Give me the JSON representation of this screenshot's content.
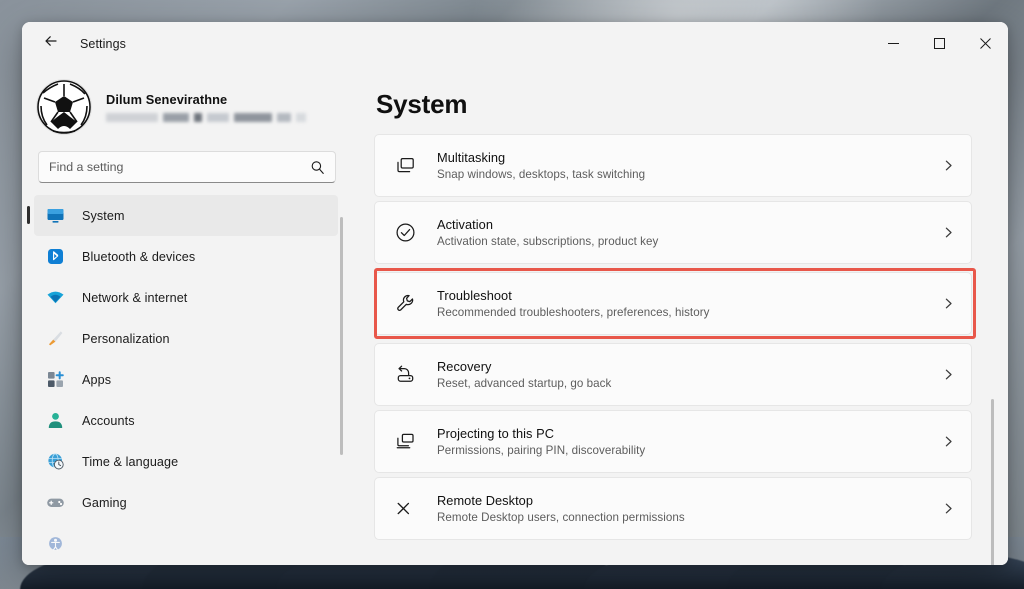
{
  "window": {
    "app_title": "Settings",
    "back_icon": "back-arrow-icon",
    "controls": {
      "minimize": "minimize-icon",
      "maximize": "maximize-icon",
      "close": "close-icon"
    }
  },
  "sidebar": {
    "profile": {
      "name": "Dilum Senevirathne",
      "account_line_redacted": true,
      "avatar_icon": "soccer-ball-avatar"
    },
    "search": {
      "placeholder": "Find a setting",
      "value": "",
      "icon": "search-icon"
    },
    "items": [
      {
        "label": "System",
        "icon": "monitor-icon",
        "active": true
      },
      {
        "label": "Bluetooth & devices",
        "icon": "bluetooth-icon",
        "active": false
      },
      {
        "label": "Network & internet",
        "icon": "wifi-icon",
        "active": false
      },
      {
        "label": "Personalization",
        "icon": "paintbrush-icon",
        "active": false
      },
      {
        "label": "Apps",
        "icon": "apps-grid-icon",
        "active": false
      },
      {
        "label": "Accounts",
        "icon": "person-icon",
        "active": false
      },
      {
        "label": "Time & language",
        "icon": "clock-globe-icon",
        "active": false
      },
      {
        "label": "Gaming",
        "icon": "gamepad-icon",
        "active": false
      }
    ]
  },
  "main": {
    "title": "System",
    "cards": [
      {
        "title": "Multitasking",
        "subtitle": "Snap windows, desktops, task switching",
        "icon": "multitasking-windows-icon",
        "highlighted": false
      },
      {
        "title": "Activation",
        "subtitle": "Activation state, subscriptions, product key",
        "icon": "check-circle-icon",
        "highlighted": false
      },
      {
        "title": "Troubleshoot",
        "subtitle": "Recommended troubleshooters, preferences, history",
        "icon": "wrench-icon",
        "highlighted": true
      },
      {
        "title": "Recovery",
        "subtitle": "Reset, advanced startup, go back",
        "icon": "recovery-icon",
        "highlighted": false
      },
      {
        "title": "Projecting to this PC",
        "subtitle": "Permissions, pairing PIN, discoverability",
        "icon": "projecting-icon",
        "highlighted": false
      },
      {
        "title": "Remote Desktop",
        "subtitle": "Remote Desktop users, connection permissions",
        "icon": "remote-desktop-icon",
        "highlighted": false
      }
    ],
    "chevron_icon": "chevron-right-icon"
  },
  "colors": {
    "highlight": "#e8574a",
    "window_bg": "#f3f3f3",
    "card_bg": "#fbfbfb",
    "accent_pill": "#2e2e2e"
  }
}
